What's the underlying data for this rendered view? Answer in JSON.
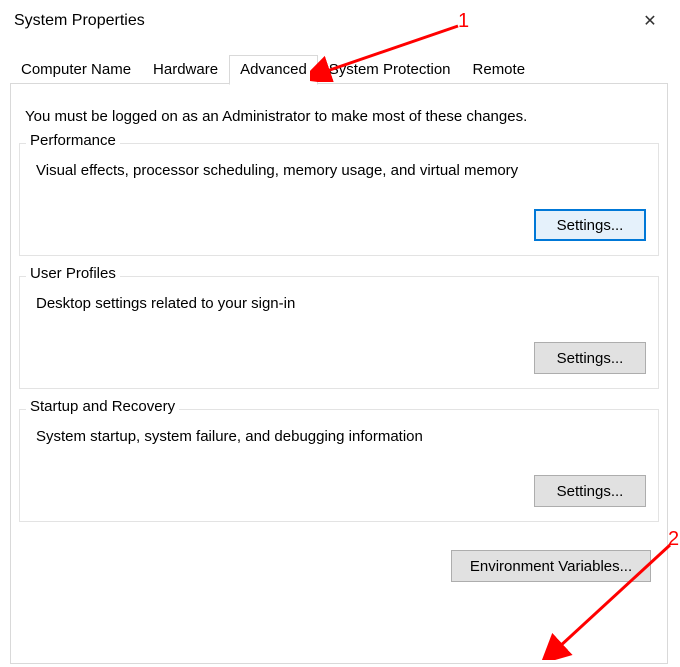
{
  "window": {
    "title": "System Properties"
  },
  "tabs": [
    {
      "label": "Computer Name"
    },
    {
      "label": "Hardware"
    },
    {
      "label": "Advanced"
    },
    {
      "label": "System Protection"
    },
    {
      "label": "Remote"
    }
  ],
  "panel": {
    "admin_note": "You must be logged on as an Administrator to make most of these changes.",
    "performance": {
      "legend": "Performance",
      "desc": "Visual effects, processor scheduling, memory usage, and virtual memory",
      "settings_label": "Settings..."
    },
    "user_profiles": {
      "legend": "User Profiles",
      "desc": "Desktop settings related to your sign-in",
      "settings_label": "Settings..."
    },
    "startup": {
      "legend": "Startup and Recovery",
      "desc": "System startup, system failure, and debugging information",
      "settings_label": "Settings..."
    },
    "env_vars_label": "Environment Variables..."
  },
  "annotations": {
    "one": "1",
    "two": "2"
  }
}
